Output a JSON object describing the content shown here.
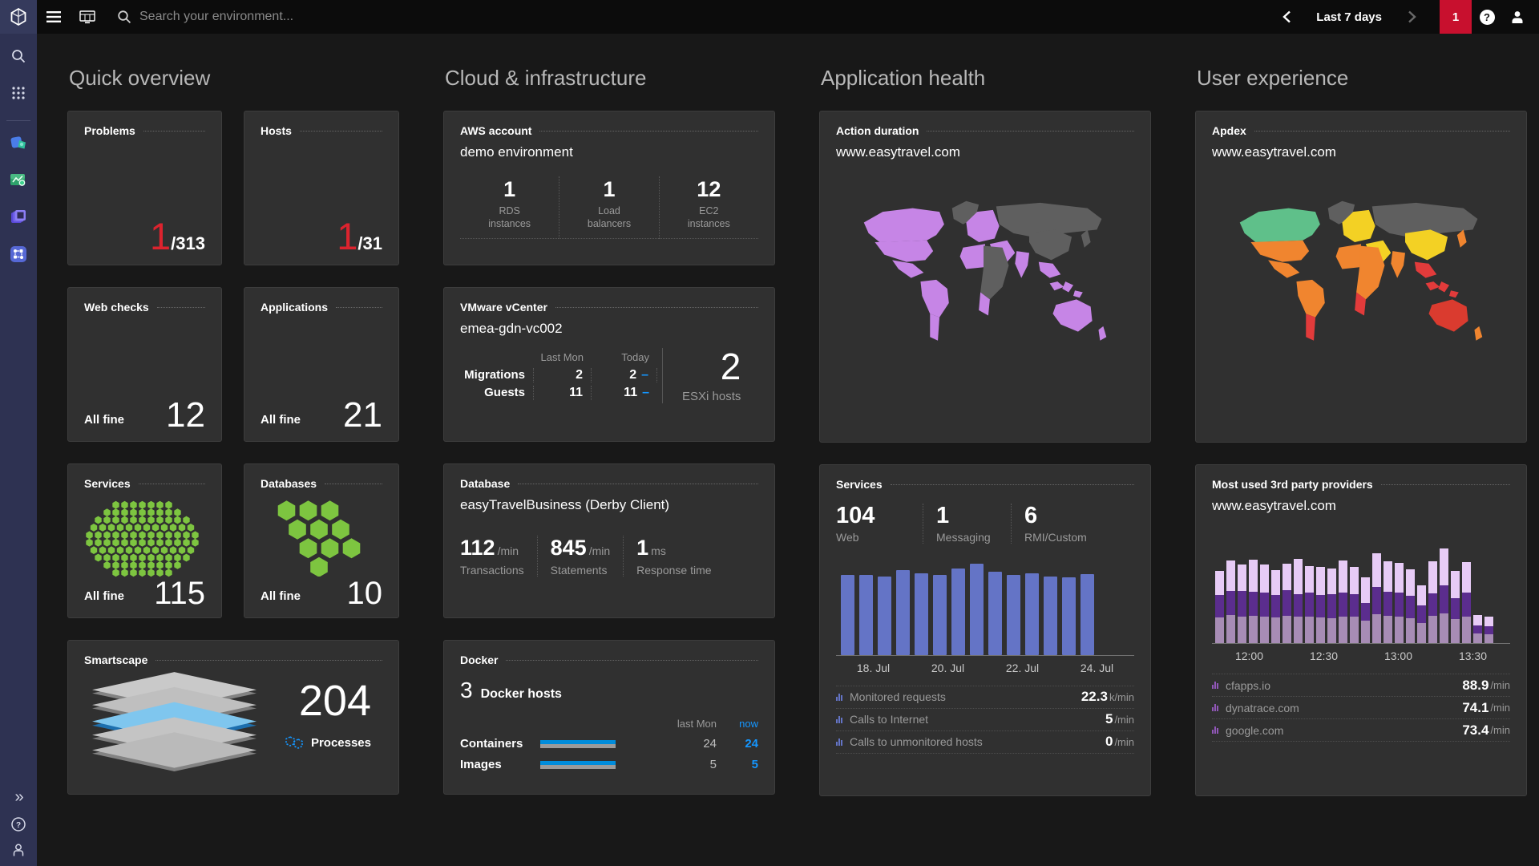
{
  "topbar": {
    "search_placeholder": "Search your environment...",
    "time_range": "Last 7 days",
    "problem_count": "1"
  },
  "quick_overview": {
    "header": "Quick overview",
    "problems": {
      "title": "Problems",
      "value": "1",
      "total": "/313"
    },
    "hosts": {
      "title": "Hosts",
      "value": "1",
      "total": "/31"
    },
    "web_checks": {
      "title": "Web checks",
      "status": "All fine",
      "count": "12"
    },
    "applications": {
      "title": "Applications",
      "status": "All fine",
      "count": "21"
    },
    "services": {
      "title": "Services",
      "status": "All fine",
      "count": "115",
      "hex_color": "#7dc540"
    },
    "databases": {
      "title": "Databases",
      "status": "All fine",
      "count": "10",
      "hex_color": "#7dc540"
    },
    "smartscape": {
      "title": "Smartscape",
      "count": "204",
      "label": "Processes"
    }
  },
  "cloud": {
    "header": "Cloud & infrastructure",
    "aws": {
      "title": "AWS account",
      "subtitle": "demo environment",
      "stats": [
        {
          "value": "1",
          "label_line1": "RDS",
          "label_line2": "instances"
        },
        {
          "value": "1",
          "label_line1": "Load",
          "label_line2": "balancers"
        },
        {
          "value": "12",
          "label_line1": "EC2",
          "label_line2": "instances"
        }
      ]
    },
    "vmware": {
      "title": "VMware vCenter",
      "subtitle": "emea-gdn-vc002",
      "col_last": "Last Mon",
      "col_today": "Today",
      "rows": [
        {
          "label": "Migrations",
          "last": "2",
          "today": "2"
        },
        {
          "label": "Guests",
          "last": "11",
          "today": "11"
        }
      ],
      "esxi_value": "2",
      "esxi_label": "ESXi hosts"
    },
    "database": {
      "title": "Database",
      "subtitle": "easyTravelBusiness (Derby Client)",
      "stats": [
        {
          "value": "112",
          "unit": "/min",
          "label": "Transactions"
        },
        {
          "value": "845",
          "unit": "/min",
          "label": "Statements"
        },
        {
          "value": "1",
          "unit": "ms",
          "label": "Response time"
        }
      ]
    },
    "docker": {
      "title": "Docker",
      "hosts_value": "3",
      "hosts_label": "Docker hosts",
      "col_last": "last Mon",
      "col_now": "now",
      "rows": [
        {
          "label": "Containers",
          "last": "24",
          "now": "24"
        },
        {
          "label": "Images",
          "last": "5",
          "now": "5"
        }
      ]
    }
  },
  "app_health": {
    "header": "Application health",
    "action_duration": {
      "title": "Action duration",
      "subtitle": "www.easytravel.com",
      "map_colors": {
        "greenland": "#5f5f5f",
        "canada": "#c685e6",
        "usa": "#c685e6",
        "mexico": "#c685e6",
        "south_america": "#c685e6",
        "argentina": "#c685e6",
        "europe": "#c685e6",
        "russia": "#5f5f5f",
        "middle_east": "#c685e6",
        "africa_west": "#c685e6",
        "africa_main": "#5f5f5f",
        "africa_south": "#c685e6",
        "india": "#c685e6",
        "china": "#5f5f5f",
        "se_asia": "#c685e6",
        "japan": "#5f5f5f",
        "australia": "#c685e6",
        "new_zealand": "#c685e6"
      }
    },
    "services": {
      "title": "Services",
      "stats": [
        {
          "value": "104",
          "label": "Web"
        },
        {
          "value": "1",
          "label": "Messaging"
        },
        {
          "value": "6",
          "label": "RMI/Custom"
        }
      ],
      "chart_data": {
        "type": "bar",
        "color": "#6474c6",
        "x_labels": [
          "18. Jul",
          "20. Jul",
          "22. Jul",
          "24. Jul"
        ],
        "values": [
          100,
          100,
          98,
          106,
          102,
          100,
          108,
          114,
          104,
          100,
          102,
          98,
          97,
          101
        ]
      },
      "rows": [
        {
          "label": "Monitored requests",
          "value": "22.3",
          "unit": "k/min"
        },
        {
          "label": "Calls to Internet",
          "value": "5",
          "unit": "/min"
        },
        {
          "label": "Calls to unmonitored hosts",
          "value": "0",
          "unit": "/min"
        }
      ]
    }
  },
  "user_experience": {
    "header": "User experience",
    "apdex": {
      "title": "Apdex",
      "subtitle": "www.easytravel.com",
      "map_colors": {
        "greenland": "#5f5f5f",
        "canada": "#5fc08a",
        "usa": "#f0852f",
        "mexico": "#f0852f",
        "south_america": "#f0852f",
        "argentina": "#e23b3b",
        "europe": "#f3d124",
        "russia": "#5f5f5f",
        "middle_east": "#f3d124",
        "africa_west": "#f0852f",
        "africa_main": "#f0852f",
        "africa_south": "#e23b3b",
        "india": "#f0852f",
        "china": "#f3d124",
        "se_asia": "#e23b3b",
        "japan": "#f0852f",
        "australia": "#da3b2f",
        "new_zealand": "#f0852f"
      }
    },
    "providers": {
      "title": "Most used 3rd party providers",
      "subtitle": "www.easytravel.com",
      "chart_data": {
        "type": "stacked-bar",
        "colors": [
          "#a78cb5",
          "#5b2d8e",
          "#e7cbf6"
        ],
        "x_labels": [
          "12:00",
          "12:30",
          "13:00",
          "13:30"
        ],
        "bars": [
          [
            32,
            28,
            30
          ],
          [
            35,
            30,
            38
          ],
          [
            33,
            32,
            33
          ],
          [
            34,
            30,
            40
          ],
          [
            33,
            30,
            35
          ],
          [
            32,
            28,
            31
          ],
          [
            34,
            32,
            33
          ],
          [
            33,
            28,
            44
          ],
          [
            33,
            30,
            33
          ],
          [
            32,
            28,
            35
          ],
          [
            31,
            30,
            32
          ],
          [
            33,
            30,
            40
          ],
          [
            33,
            28,
            34
          ],
          [
            28,
            22,
            32
          ],
          [
            36,
            34,
            42
          ],
          [
            34,
            30,
            38
          ],
          [
            33,
            30,
            37
          ],
          [
            31,
            28,
            33
          ],
          [
            25,
            22,
            25
          ],
          [
            34,
            28,
            40
          ],
          [
            37,
            35,
            46
          ],
          [
            30,
            26,
            34
          ],
          [
            33,
            30,
            38
          ],
          [
            12,
            10,
            13
          ],
          [
            11,
            10,
            12
          ]
        ]
      },
      "rows": [
        {
          "label": "cfapps.io",
          "value": "88.9",
          "unit": "/min"
        },
        {
          "label": "dynatrace.com",
          "value": "74.1",
          "unit": "/min"
        },
        {
          "label": "google.com",
          "value": "73.4",
          "unit": "/min"
        }
      ]
    }
  }
}
